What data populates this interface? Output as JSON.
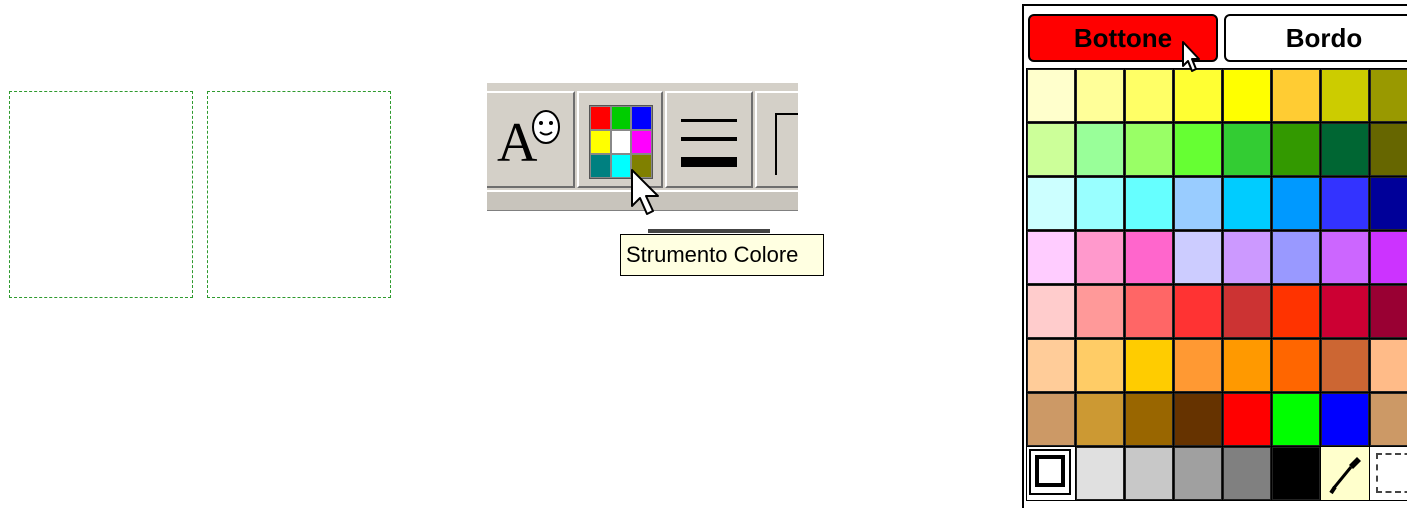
{
  "toolbar": {
    "tooltip": "Strumento Colore",
    "mini_palette": [
      "#ff0000",
      "#00cc00",
      "#0000ff",
      "#ffff00",
      "#ffffff",
      "#ff00ff",
      "#008080",
      "#00ffff",
      "#808000"
    ]
  },
  "panel": {
    "tabs": [
      {
        "label": "Bottone",
        "active": true,
        "color": "#ff0000"
      },
      {
        "label": "Bordo",
        "active": false,
        "color": "#ffffff"
      }
    ],
    "swatch_rows": [
      [
        "#ffffcc",
        "#ffff99",
        "#ffff66",
        "#ffff33",
        "#ffff00",
        "#ffcc33",
        "#cccc00",
        "#999900"
      ],
      [
        "#ccff99",
        "#99ff99",
        "#99ff66",
        "#66ff33",
        "#33cc33",
        "#339900",
        "#006633",
        "#666600"
      ],
      [
        "#ccffff",
        "#99ffff",
        "#66ffff",
        "#99ccff",
        "#00ccff",
        "#0099ff",
        "#3333ff",
        "#000099"
      ],
      [
        "#ffccff",
        "#ff99cc",
        "#ff66cc",
        "#ccccff",
        "#cc99ff",
        "#9999ff",
        "#cc66ff",
        "#cc33ff"
      ],
      [
        "#ffcccc",
        "#ff9999",
        "#ff6666",
        "#ff3333",
        "#cc3333",
        "#ff3300",
        "#cc0033",
        "#990033"
      ],
      [
        "#ffcc99",
        "#ffcc66",
        "#ffcc00",
        "#ff9933",
        "#ff9900",
        "#ff6600",
        "#cc6633",
        "#ffbb88"
      ],
      [
        "#cc9966",
        "#cc9933",
        "#996600",
        "#663300",
        "#ff0000",
        "#00ff00",
        "#0000ff",
        "#cc9966"
      ]
    ],
    "bottom_row": {
      "grays": [
        "#e0e0e0",
        "#c8c8c8",
        "#a0a0a0",
        "#808080",
        "#000000"
      ],
      "tools": [
        "no-fill-icon",
        "eyedropper-icon",
        "transparent-icon"
      ]
    }
  }
}
